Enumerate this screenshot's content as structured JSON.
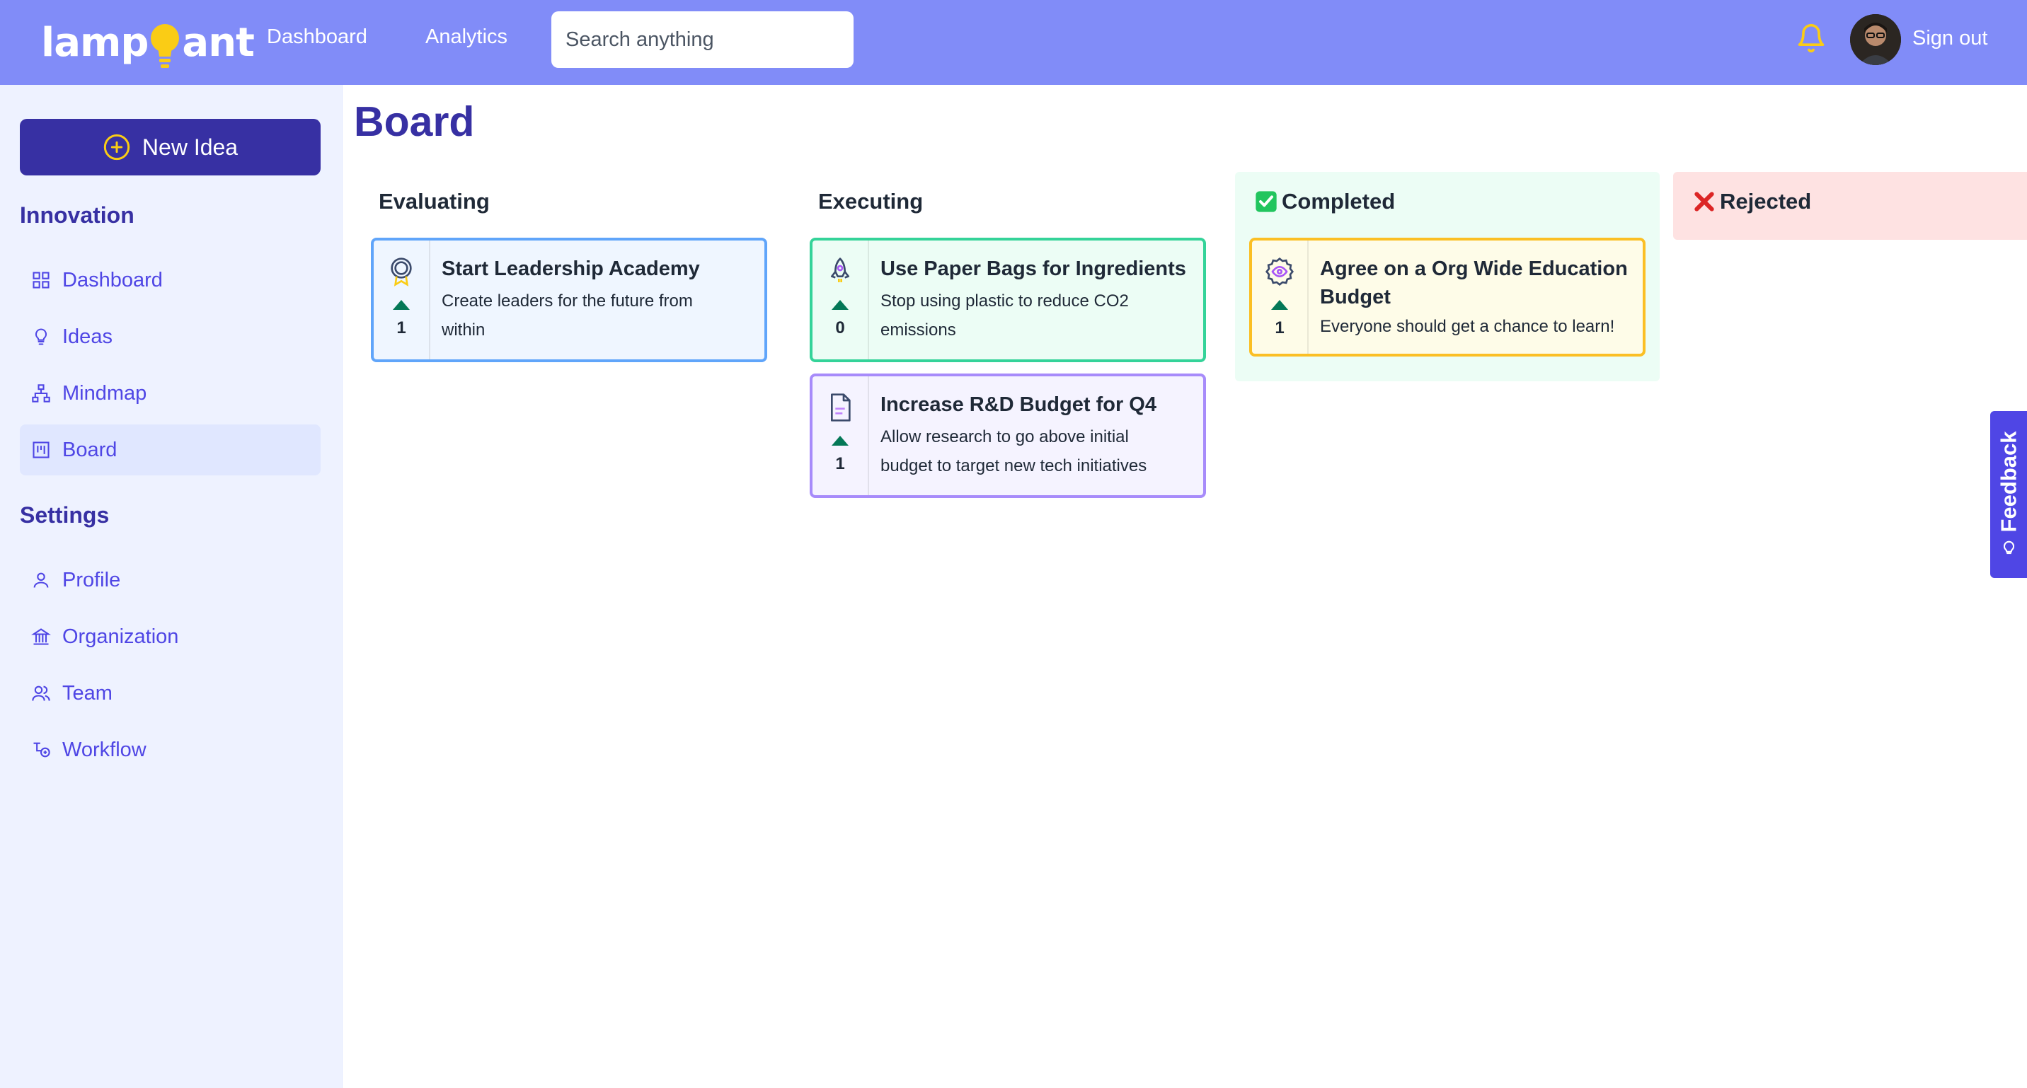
{
  "header": {
    "logo_text_left": "lamp",
    "logo_text_right": "ant",
    "nav": [
      {
        "label": "Dashboard"
      },
      {
        "label": "Analytics"
      }
    ],
    "search_placeholder": "Search anything",
    "sign_out_label": "Sign out",
    "colors": {
      "bar": "#818cf8",
      "bell": "#facc15"
    }
  },
  "sidebar": {
    "new_idea_label": "New Idea",
    "innovation_title": "Innovation",
    "innovation_items": [
      {
        "label": "Dashboard",
        "icon": "grid-icon"
      },
      {
        "label": "Ideas",
        "icon": "lightbulb-icon"
      },
      {
        "label": "Mindmap",
        "icon": "hierarchy-icon"
      },
      {
        "label": "Board",
        "icon": "kanban-icon",
        "active": true
      }
    ],
    "settings_title": "Settings",
    "settings_items": [
      {
        "label": "Profile",
        "icon": "user-icon"
      },
      {
        "label": "Organization",
        "icon": "building-icon"
      },
      {
        "label": "Team",
        "icon": "users-icon"
      },
      {
        "label": "Workflow",
        "icon": "workflow-icon"
      }
    ]
  },
  "main": {
    "title": "Board",
    "columns": [
      {
        "title": "Evaluating",
        "cards": [
          {
            "title": "Start Leadership Academy",
            "desc_lines": [
              "Create leaders for the future from",
              "within"
            ],
            "votes": "1",
            "icon": "award-icon"
          }
        ]
      },
      {
        "title": "Executing",
        "cards": [
          {
            "title": "Use Paper Bags for Ingredients",
            "desc_lines": [
              "Stop using plastic to reduce CO2",
              "emissions"
            ],
            "votes": "0",
            "icon": "rocket-icon"
          },
          {
            "title": "Increase R&D Budget for Q4",
            "desc_lines": [
              "Allow research to go above initial",
              "budget to target new tech initiatives"
            ],
            "votes": "1",
            "icon": "document-icon"
          }
        ]
      },
      {
        "title": "Completed",
        "status_icon": "check-mark-icon",
        "cards": [
          {
            "title_lines": [
              "Agree on a Org Wide Education",
              "Budget"
            ],
            "desc_lines": [
              "Everyone should get a chance to learn!"
            ],
            "votes": "1",
            "icon": "eye-badge-icon"
          }
        ]
      },
      {
        "title": "Rejected",
        "status_icon": "cross-mark-icon",
        "cards": []
      }
    ]
  },
  "feedback_label": "Feedback"
}
